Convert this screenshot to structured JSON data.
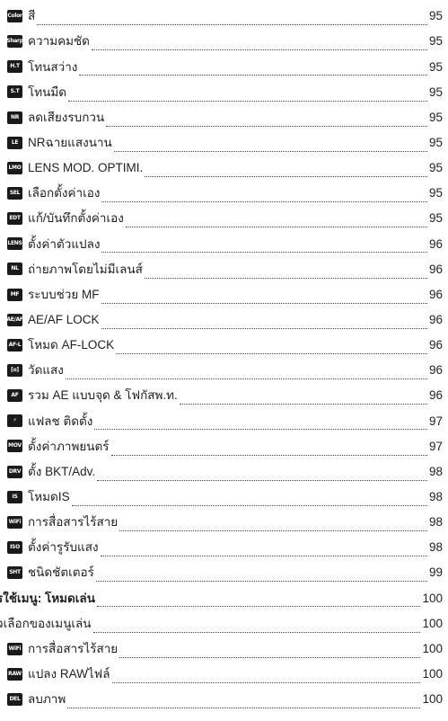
{
  "entries": [
    {
      "icon": "Color",
      "label": "สี",
      "page": "95"
    },
    {
      "icon": "Sharp",
      "label": "ความคมชัด",
      "page": "95"
    },
    {
      "icon": "H.T",
      "label": "โทนสว่าง",
      "page": "95"
    },
    {
      "icon": "S.T",
      "label": "โทนมืด",
      "page": "95"
    },
    {
      "icon": "NR",
      "label": "ลดเสียงรบกวน",
      "page": "95"
    },
    {
      "icon": "LE",
      "label": "NRฉายแสงนาน",
      "page": "95"
    },
    {
      "icon": "LMO",
      "label": "LENS MOD. OPTIMI.",
      "page": "95"
    },
    {
      "icon": "SEL",
      "label": "เลือกตั้งค่าเอง",
      "page": "95"
    },
    {
      "icon": "EDT",
      "label": "แก้/บันทึกตั้งค่าเอง",
      "page": "95"
    },
    {
      "icon": "LENS",
      "label": "ตั้งค่าตัวแปลง",
      "page": "96"
    },
    {
      "icon": "NL",
      "label": "ถ่ายภาพโดยไม่มีเลนส์",
      "page": "96"
    },
    {
      "icon": "MF",
      "label": "ระบบช่วย MF",
      "page": "96"
    },
    {
      "icon": "AE/AF",
      "label": "AE/AF LOCK",
      "page": "96"
    },
    {
      "icon": "AF-L",
      "label": "โหมด AF-LOCK",
      "page": "96"
    },
    {
      "icon": "[o]",
      "label": "วัดแสง",
      "page": "96"
    },
    {
      "icon": "AF",
      "label": "รวม AE แบบจุด & โฟกัสพ.ท.",
      "page": "96"
    },
    {
      "icon": "⚡",
      "label": "แฟลช ติดตั้ง",
      "page": "97"
    },
    {
      "icon": "MOV",
      "label": "ตั้งค่าภาพยนตร์",
      "page": "97"
    },
    {
      "icon": "DRV",
      "label": "ตั้ง BKT/Adv.",
      "page": "98"
    },
    {
      "icon": "IS",
      "label": "โหมดIS",
      "page": "98"
    },
    {
      "icon": "WiFi",
      "label": "การสื่อสารไร้สาย",
      "page": "98"
    },
    {
      "icon": "ISO",
      "label": "ตั้งค่ารูรับแสง",
      "page": "98"
    },
    {
      "icon": "SHT",
      "label": "ชนิดชัตเตอร์",
      "page": "99"
    }
  ],
  "section_head": {
    "label": "รใช้เมนู: โหมดเล่น",
    "page": "100"
  },
  "section_sub": {
    "label": "ัวเลือกของเมนูเล่น",
    "page": "100"
  },
  "play_entries": [
    {
      "icon": "WiFi",
      "label": "การสื่อสารไร้สาย",
      "page": "100"
    },
    {
      "icon": "RAW",
      "label": "แปลง RAWไฟล์",
      "page": "100"
    },
    {
      "icon": "DEL",
      "label": "ลบภาพ",
      "page": "100"
    }
  ]
}
